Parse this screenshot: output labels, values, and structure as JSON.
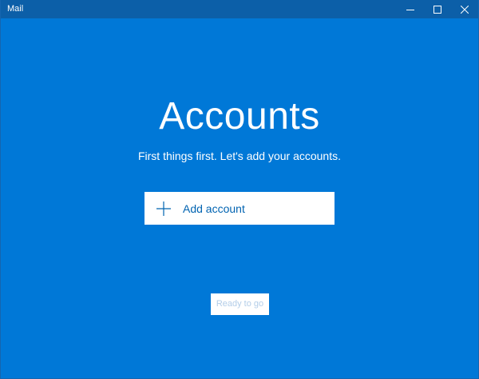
{
  "window": {
    "title": "Mail"
  },
  "main": {
    "heading": "Accounts",
    "subtitle": "First things first. Let's add your accounts.",
    "add_account_label": "Add account",
    "ready_label": "Ready to go"
  },
  "icons": {
    "minimize": "minimize-icon",
    "maximize": "maximize-icon",
    "close": "close-icon",
    "add": "plus-icon"
  },
  "colors": {
    "background": "#0078d7",
    "titlebar": "#0c5fa8",
    "accent_text": "#0063b1",
    "disabled_text": "#b3cde8"
  }
}
